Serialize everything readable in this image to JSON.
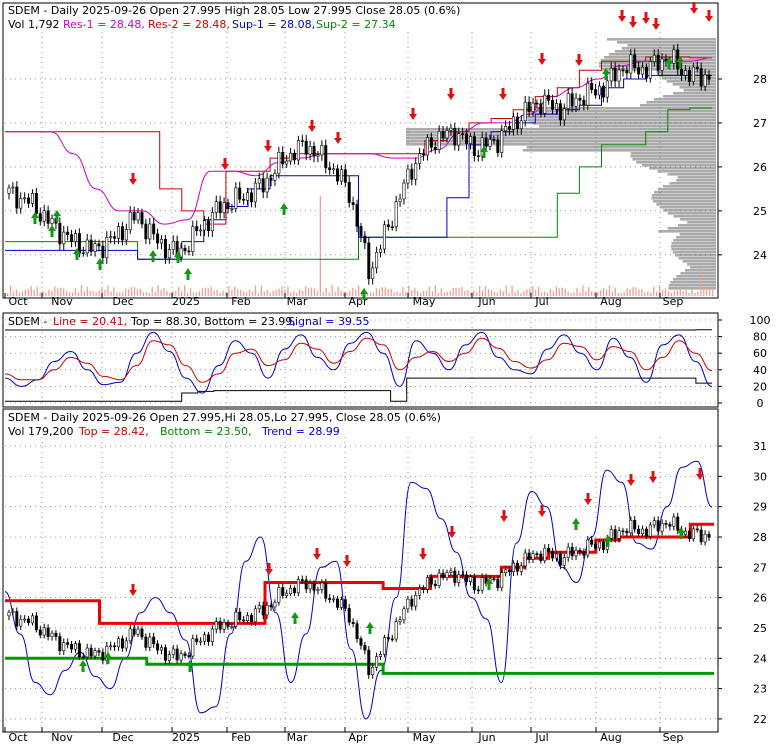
{
  "panel1": {
    "header_line1": "SDEM - Daily 2025-09-26 Open 27.995  High 28.05  Low 27.995  Close 28.05 (0.6%)",
    "vol_text": "Vol 1,792",
    "res1_text": "Res-1 = 28.48,",
    "res2_text": "Res-2 = 28.48,",
    "sup1_text": "Sup-1 = 28.08,",
    "sup2_text": "Sup-2 = 27.34"
  },
  "panel2": {
    "sdem_text": "SDEM -",
    "line_text": "Line = 20.41,",
    "topbottom_text": "Top = 88.30,  Bottom = 23.99,",
    "signal_text": "Signal = 39.55"
  },
  "panel3": {
    "header_line1": "SDEM - Daily 2025-09-26 Open 27.995,Hi 28.05,Lo 27.995,  Close 28.05 (0.6%)",
    "vol_text": "Vol 179,200",
    "top_text": "Top = 28.42,",
    "bottom_text": "Bottom = 23.50,",
    "trend_text": "Trend = 28.99"
  },
  "colors": {
    "res1": "#cc00cc",
    "res2": "#cc0000",
    "sup1": "#0000cc",
    "sup2": "#008800",
    "up_arrow": "#119911",
    "down_arrow": "#dd1111",
    "volume": "#f0a090",
    "profile": "#aaaaaa",
    "signal": "#cc0000"
  },
  "chart_data": [
    {
      "type": "candlestick",
      "x_labels": [
        "Oct",
        "Nov",
        "Dec",
        "2025",
        "Feb",
        "Mar",
        "Apr",
        "May",
        "Jun",
        "Jul",
        "Aug",
        "Sep"
      ],
      "y_ticks": [
        24,
        25,
        26,
        27,
        28
      ],
      "ylim": [
        23.2,
        29.0
      ],
      "close_approx": [
        25.4,
        25.2,
        24.7,
        24.3,
        24.1,
        24.4,
        24.9,
        24.3,
        24.0,
        24.6,
        25.1,
        25.3,
        25.6,
        26.2,
        26.5,
        26.1,
        25.5,
        23.6,
        24.8,
        26.0,
        26.6,
        26.8,
        26.4,
        26.6,
        27.1,
        27.5,
        27.3,
        27.6,
        27.8,
        28.3,
        28.2,
        28.5,
        28.1,
        28.05
      ],
      "res1_line": [
        26.8,
        26.8,
        26.8,
        26.3,
        25.5,
        25.0,
        25.0,
        24.7,
        24.8,
        25.9,
        25.9,
        25.8,
        26.1,
        26.2,
        26.3,
        26.3,
        26.3,
        26.2,
        26.2,
        26.4,
        26.8,
        27.0,
        27.0,
        27.2,
        27.6,
        27.8,
        28.0,
        28.3,
        28.4,
        28.4,
        28.4,
        28.48
      ],
      "res2_line": [
        26.8,
        26.8,
        26.8,
        26.8,
        26.8,
        26.8,
        26.8,
        25.5,
        25.0,
        24.7,
        25.9,
        25.9,
        26.2,
        26.3,
        26.3,
        26.3,
        26.3,
        26.3,
        26.3,
        26.6,
        26.8,
        27.0,
        27.1,
        27.3,
        27.6,
        27.8,
        28.2,
        28.4,
        28.4,
        28.5,
        28.5,
        28.48
      ],
      "sup1_line": [
        24.1,
        24.1,
        24.1,
        24.1,
        24.1,
        24.1,
        23.9,
        23.9,
        24.3,
        24.8,
        25.1,
        25.5,
        25.8,
        25.8,
        25.8,
        25.8,
        24.4,
        24.4,
        24.4,
        24.4,
        25.3,
        26.5,
        26.8,
        27.0,
        27.2,
        27.3,
        27.4,
        27.8,
        28.0,
        28.08,
        28.08,
        28.08
      ],
      "sup2_line": [
        24.3,
        24.3,
        24.3,
        24.3,
        24.3,
        24.3,
        23.9,
        23.9,
        23.9,
        23.9,
        23.9,
        23.9,
        23.9,
        23.9,
        23.9,
        23.9,
        24.4,
        24.4,
        24.4,
        24.4,
        24.4,
        24.4,
        24.4,
        24.4,
        24.4,
        25.4,
        26.0,
        26.5,
        26.5,
        26.8,
        27.3,
        27.34
      ]
    },
    {
      "type": "line",
      "y_ticks": [
        0,
        20,
        40,
        60,
        80,
        100
      ],
      "ylim": [
        0,
        100
      ],
      "series": [
        {
          "name": "Line",
          "values": [
            30,
            20,
            28,
            50,
            62,
            40,
            22,
            25,
            60,
            85,
            62,
            30,
            12,
            45,
            75,
            60,
            30,
            65,
            82,
            55,
            40,
            72,
            85,
            60,
            20,
            75,
            60,
            40,
            70,
            85,
            55,
            40,
            35,
            65,
            82,
            60,
            40,
            78,
            55,
            25,
            70,
            82,
            50,
            20
          ]
        },
        {
          "name": "Signal",
          "values": [
            35,
            28,
            28,
            40,
            55,
            48,
            32,
            28,
            45,
            75,
            70,
            45,
            25,
            35,
            60,
            65,
            45,
            52,
            72,
            65,
            48,
            62,
            78,
            70,
            40,
            55,
            62,
            50,
            60,
            78,
            66,
            50,
            42,
            52,
            72,
            68,
            52,
            68,
            62,
            40,
            55,
            75,
            60,
            39
          ]
        },
        {
          "name": "Top",
          "values": [
            88,
            88,
            88,
            88,
            88,
            88,
            88,
            88,
            88,
            88,
            88,
            88,
            88,
            88,
            88,
            88,
            88,
            88,
            88,
            88,
            88,
            88,
            88,
            88,
            88,
            88,
            88,
            88,
            88,
            88,
            88,
            88,
            88,
            88,
            88,
            88,
            88,
            88,
            88,
            88,
            88,
            88,
            88,
            88.3
          ]
        },
        {
          "name": "Bottom",
          "values": [
            2,
            2,
            2,
            2,
            2,
            2,
            2,
            2,
            2,
            2,
            2,
            12,
            14,
            15,
            15,
            15,
            15,
            15,
            15,
            15,
            15,
            15,
            15,
            15,
            2,
            30,
            30,
            30,
            30,
            30,
            30,
            30,
            30,
            30,
            30,
            30,
            30,
            30,
            30,
            30,
            30,
            30,
            30,
            24
          ]
        }
      ]
    },
    {
      "type": "candlestick",
      "x_labels": [
        "Oct",
        "Nov",
        "Dec",
        "2025",
        "Feb",
        "Mar",
        "Apr",
        "May",
        "Jun",
        "Jul",
        "Aug",
        "Sep"
      ],
      "y_ticks": [
        22,
        23,
        24,
        25,
        26,
        27,
        28,
        29,
        30,
        31
      ],
      "ylim": [
        21.7,
        31.2
      ],
      "close_approx": [
        25.4,
        25.2,
        24.7,
        24.3,
        24.1,
        24.4,
        24.9,
        24.3,
        24.0,
        24.6,
        25.1,
        25.3,
        25.6,
        26.2,
        26.5,
        26.1,
        25.5,
        23.6,
        24.8,
        26.0,
        26.6,
        26.8,
        26.4,
        26.6,
        27.1,
        27.5,
        27.3,
        27.6,
        27.8,
        28.3,
        28.2,
        28.5,
        28.1,
        28.05
      ],
      "trend_line": [
        26.2,
        24.8,
        23.2,
        22.8,
        23.6,
        24.2,
        23.4,
        23.0,
        24.0,
        25.5,
        26.0,
        25.5,
        24.6,
        22.2,
        22.4,
        24.8,
        27.2,
        28.0,
        25.5,
        23.2,
        24.8,
        27.0,
        27.2,
        24.3,
        22.0,
        23.6,
        26.0,
        29.8,
        29.6,
        28.6,
        27.5,
        26.0,
        25.3,
        23.2,
        27.8,
        29.5,
        29.0,
        27.0,
        26.5,
        28.0,
        30.2,
        29.8,
        27.8,
        27.6,
        29.0,
        30.3,
        30.5,
        28.99
      ],
      "top_line": [
        25.9,
        25.9,
        25.9,
        25.9,
        25.15,
        25.15,
        25.15,
        25.15,
        25.15,
        25.15,
        25.15,
        26.5,
        26.5,
        26.5,
        26.5,
        26.5,
        26.3,
        26.3,
        26.7,
        26.7,
        26.7,
        27.0,
        27.3,
        27.5,
        27.5,
        27.9,
        28.0,
        28.0,
        28.0,
        28.42
      ],
      "bottom_line": [
        24.0,
        24.0,
        24.0,
        24.0,
        24.0,
        24.0,
        23.8,
        23.8,
        23.8,
        23.8,
        23.8,
        23.8,
        23.8,
        23.8,
        23.8,
        23.8,
        23.5,
        23.5,
        23.5,
        23.5,
        23.5,
        23.5,
        23.5,
        23.5,
        23.5,
        23.5,
        23.5,
        23.5,
        23.5,
        23.5
      ]
    }
  ]
}
